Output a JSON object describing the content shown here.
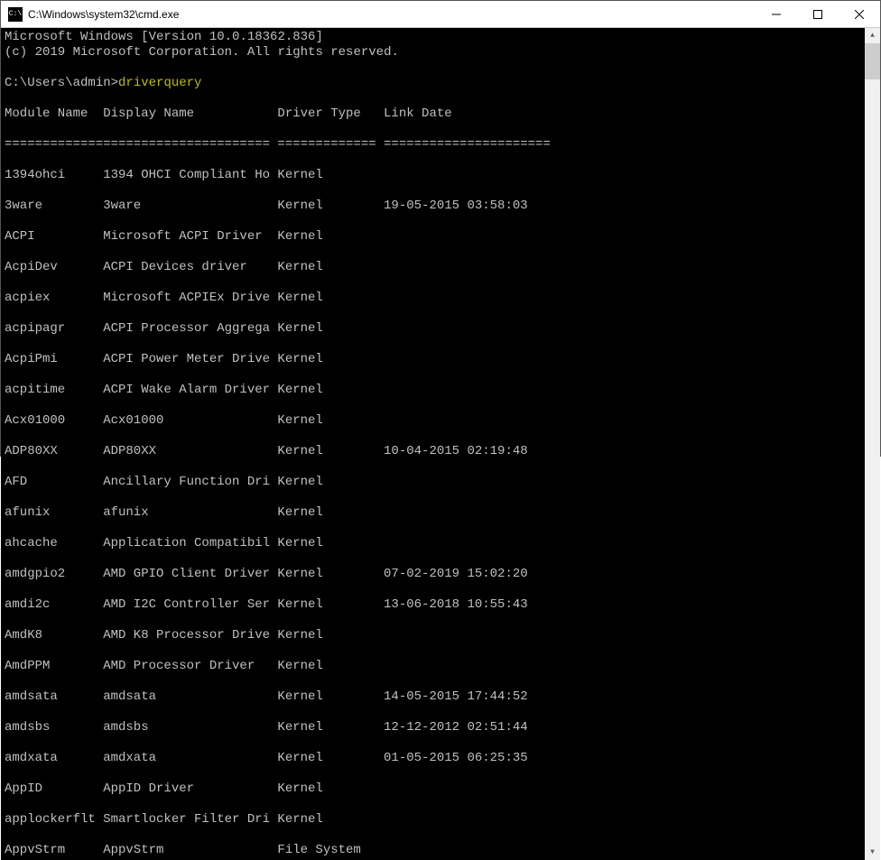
{
  "window": {
    "title": "C:\\Windows\\system32\\cmd.exe"
  },
  "header": {
    "line1": "Microsoft Windows [Version 10.0.18362.836]",
    "line2": "(c) 2019 Microsoft Corporation. All rights reserved."
  },
  "prompt": {
    "path": "C:\\Users\\admin>",
    "command": "driverquery"
  },
  "columns": {
    "c1": "Module Name",
    "c2": "Display Name",
    "c3": "Driver Type",
    "c4": "Link Date"
  },
  "separator": {
    "c1": "=============",
    "c2": "======================",
    "c3": "=============",
    "c4": "======================"
  },
  "rows": [
    {
      "c1": "1394ohci",
      "c2": "1394 OHCI Compliant Ho",
      "c3": "Kernel",
      "c4": ""
    },
    {
      "c1": "3ware",
      "c2": "3ware",
      "c3": "Kernel",
      "c4": "19-05-2015 03:58:03"
    },
    {
      "c1": "ACPI",
      "c2": "Microsoft ACPI Driver",
      "c3": "Kernel",
      "c4": ""
    },
    {
      "c1": "AcpiDev",
      "c2": "ACPI Devices driver",
      "c3": "Kernel",
      "c4": ""
    },
    {
      "c1": "acpiex",
      "c2": "Microsoft ACPIEx Drive",
      "c3": "Kernel",
      "c4": ""
    },
    {
      "c1": "acpipagr",
      "c2": "ACPI Processor Aggrega",
      "c3": "Kernel",
      "c4": ""
    },
    {
      "c1": "AcpiPmi",
      "c2": "ACPI Power Meter Drive",
      "c3": "Kernel",
      "c4": ""
    },
    {
      "c1": "acpitime",
      "c2": "ACPI Wake Alarm Driver",
      "c3": "Kernel",
      "c4": ""
    },
    {
      "c1": "Acx01000",
      "c2": "Acx01000",
      "c3": "Kernel",
      "c4": ""
    },
    {
      "c1": "ADP80XX",
      "c2": "ADP80XX",
      "c3": "Kernel",
      "c4": "10-04-2015 02:19:48"
    },
    {
      "c1": "AFD",
      "c2": "Ancillary Function Dri",
      "c3": "Kernel",
      "c4": ""
    },
    {
      "c1": "afunix",
      "c2": "afunix",
      "c3": "Kernel",
      "c4": ""
    },
    {
      "c1": "ahcache",
      "c2": "Application Compatibil",
      "c3": "Kernel",
      "c4": ""
    },
    {
      "c1": "amdgpio2",
      "c2": "AMD GPIO Client Driver",
      "c3": "Kernel",
      "c4": "07-02-2019 15:02:20"
    },
    {
      "c1": "amdi2c",
      "c2": "AMD I2C Controller Ser",
      "c3": "Kernel",
      "c4": "13-06-2018 10:55:43"
    },
    {
      "c1": "AmdK8",
      "c2": "AMD K8 Processor Drive",
      "c3": "Kernel",
      "c4": ""
    },
    {
      "c1": "AmdPPM",
      "c2": "AMD Processor Driver",
      "c3": "Kernel",
      "c4": ""
    },
    {
      "c1": "amdsata",
      "c2": "amdsata",
      "c3": "Kernel",
      "c4": "14-05-2015 17:44:52"
    },
    {
      "c1": "amdsbs",
      "c2": "amdsbs",
      "c3": "Kernel",
      "c4": "12-12-2012 02:51:44"
    },
    {
      "c1": "amdxata",
      "c2": "amdxata",
      "c3": "Kernel",
      "c4": "01-05-2015 06:25:35"
    },
    {
      "c1": "AppID",
      "c2": "AppID Driver",
      "c3": "Kernel",
      "c4": ""
    },
    {
      "c1": "applockerflt",
      "c2": "Smartlocker Filter Dri",
      "c3": "Kernel",
      "c4": ""
    },
    {
      "c1": "AppvStrm",
      "c2": "AppvStrm",
      "c3": "File System",
      "c4": ""
    }
  ]
}
